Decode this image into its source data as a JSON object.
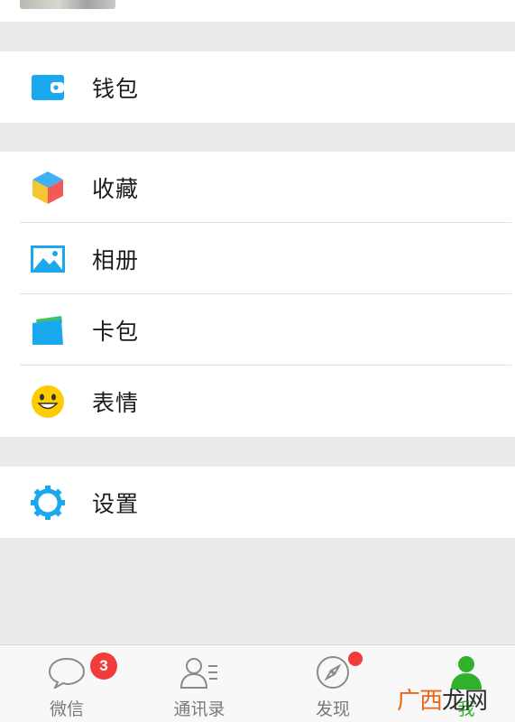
{
  "sections": [
    {
      "items": [
        {
          "label": "钱包",
          "icon": "wallet-icon"
        }
      ]
    },
    {
      "items": [
        {
          "label": "收藏",
          "icon": "favorites-cube-icon"
        },
        {
          "label": "相册",
          "icon": "album-picture-icon"
        },
        {
          "label": "卡包",
          "icon": "card-pack-icon"
        },
        {
          "label": "表情",
          "icon": "smiley-face-icon"
        }
      ]
    },
    {
      "items": [
        {
          "label": "设置",
          "icon": "gear-icon"
        }
      ]
    }
  ],
  "tabbar": {
    "tabs": [
      {
        "label": "微信",
        "icon": "chat-bubble-icon",
        "badge": "3"
      },
      {
        "label": "通讯录",
        "icon": "contacts-icon"
      },
      {
        "label": "发现",
        "icon": "compass-icon",
        "has_dot": true
      },
      {
        "label": "我",
        "icon": "person-icon",
        "active": true
      }
    ]
  },
  "watermark": {
    "part1": "广西",
    "part2": "龙网"
  },
  "colors": {
    "icon_blue": "#1aa8ee",
    "active_green": "#2fb12b",
    "badge_red": "#f23c3c",
    "smiley_yellow": "#ffcc00"
  }
}
